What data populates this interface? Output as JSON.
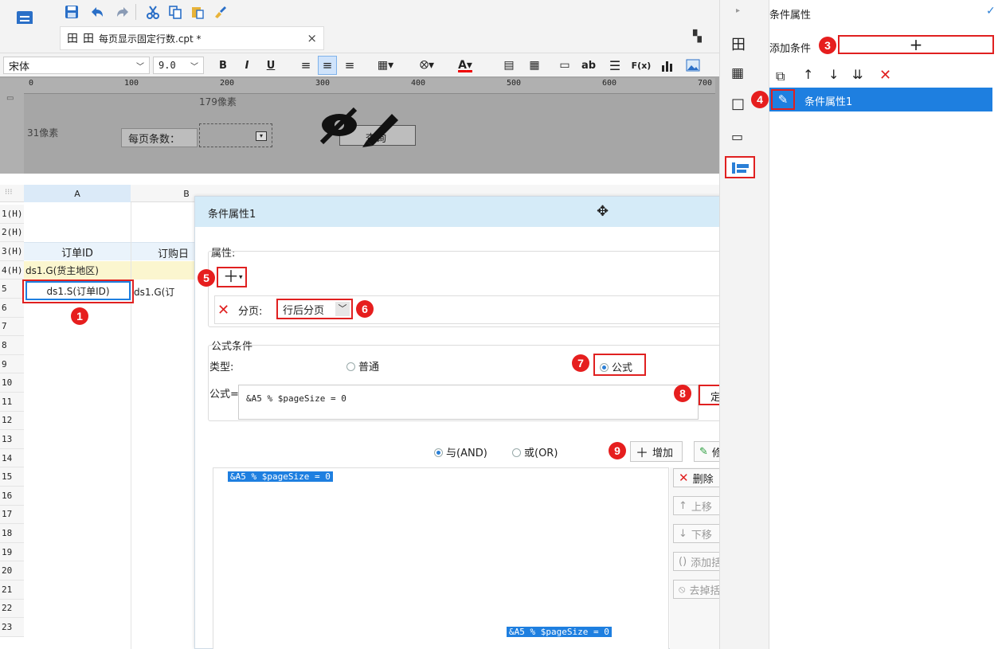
{
  "app": {
    "logo_label": "FineReport"
  },
  "toolbar": {
    "icons": [
      "save-icon",
      "undo-icon",
      "redo-icon",
      "cut-icon",
      "copy-icon",
      "paste-icon",
      "format-brush-icon"
    ]
  },
  "tab": {
    "title": "每页显示固定行数.cpt *",
    "close": "×"
  },
  "format": {
    "font": "宋体",
    "size": "9.0",
    "bold": "B",
    "italic": "I",
    "underline": "U",
    "font_color_letter": "A",
    "text_ab": "ab",
    "formula_fx": "F(x)"
  },
  "ruler": {
    "ticks": [
      "0",
      "100",
      "200",
      "300",
      "400",
      "500",
      "600",
      "700"
    ]
  },
  "design": {
    "width_label": "179像素",
    "height_label": "31像素",
    "per_page_label": "每页条数：",
    "query_button": "查询"
  },
  "sheet": {
    "col_a": "A",
    "col_b": "B",
    "rows": [
      "1(H)",
      "2(H)",
      "3(H)",
      "4(H)",
      "5",
      "6",
      "7",
      "8",
      "9",
      "10",
      "11",
      "12",
      "13",
      "14",
      "15",
      "16",
      "17",
      "18",
      "19",
      "20",
      "21",
      "22",
      "23"
    ],
    "cell_a3": "订单ID",
    "cell_b3": "订购日",
    "cell_a4": "ds1.G(货主地区)",
    "cell_a5": "ds1.S(订单ID)",
    "cell_b5": "ds1.G(订"
  },
  "dialog": {
    "title": "条件属性1",
    "prop_label": "属性:",
    "page_label": "分页:",
    "page_value": "行后分页",
    "formula_section": "公式条件",
    "type_label": "类型:",
    "normal": "普通",
    "formula": "公式",
    "formula_eq": "公式=",
    "formula_text": "&A5 % $pageSize = 0",
    "define_button": "定义",
    "and_label": "与(AND)",
    "or_label": "或(OR)",
    "add_button": "增加",
    "modify_button": "修改",
    "delete_button": "删除",
    "up_button": "上移",
    "down_button": "下移",
    "add_paren": "添加括号",
    "remove_paren": "去掉括号",
    "list_item": "&A5 % $pageSize = 0",
    "drag_text": "&A5 % $pageSize = 0"
  },
  "panel": {
    "title": "条件属性",
    "add_label": "添加条件",
    "add_plus": "+",
    "item_label": "条件属性1"
  },
  "badges": [
    "1",
    "2",
    "3",
    "4",
    "5",
    "6",
    "7",
    "8",
    "9"
  ],
  "colors": {
    "accent": "#1e7fe0",
    "badge": "#e61e1e",
    "dialog_title": "#d5ebf8"
  }
}
